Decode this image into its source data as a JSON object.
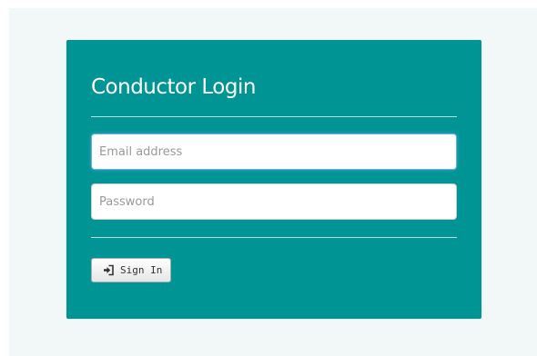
{
  "login": {
    "title": "Conductor Login",
    "email_placeholder": "Email address",
    "email_value": "",
    "password_placeholder": "Password",
    "password_value": "",
    "signin_label": "Sign In",
    "signin_icon": "sign-in-icon"
  },
  "colors": {
    "panel": "#009494",
    "page_background": "#f2f8f8",
    "focus_border": "#66afe9"
  }
}
